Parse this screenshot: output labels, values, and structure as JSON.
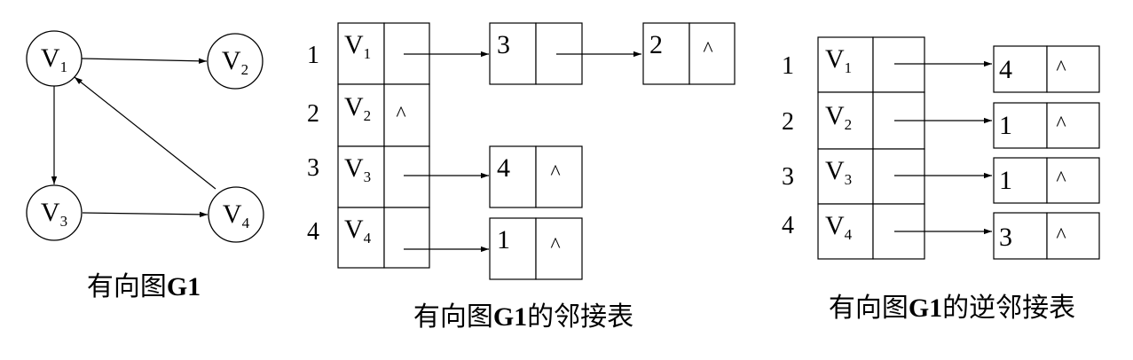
{
  "graph": {
    "vertex_base": "V",
    "nodes": [
      {
        "id": "v1",
        "sub": "1"
      },
      {
        "id": "v2",
        "sub": "2"
      },
      {
        "id": "v3",
        "sub": "3"
      },
      {
        "id": "v4",
        "sub": "4"
      }
    ],
    "edges": [
      {
        "from": "v1",
        "to": "v2"
      },
      {
        "from": "v1",
        "to": "v3"
      },
      {
        "from": "v3",
        "to": "v4"
      },
      {
        "from": "v4",
        "to": "v1"
      }
    ],
    "caption": {
      "text": "有向图",
      "bold": "G1"
    }
  },
  "adjacency_list": {
    "caption": {
      "prefix": "有向图",
      "bold": "G1",
      "suffix": "的邻接表"
    },
    "rows": [
      {
        "index": "1",
        "vertex_sub": "1",
        "head_null": false,
        "nodes": [
          {
            "value": "3",
            "null": false
          },
          {
            "value": "2",
            "null": true
          }
        ]
      },
      {
        "index": "2",
        "vertex_sub": "2",
        "head_null": true,
        "nodes": []
      },
      {
        "index": "3",
        "vertex_sub": "3",
        "head_null": false,
        "nodes": [
          {
            "value": "4",
            "null": true
          }
        ]
      },
      {
        "index": "4",
        "vertex_sub": "4",
        "head_null": false,
        "nodes": [
          {
            "value": "1",
            "null": true
          }
        ]
      }
    ]
  },
  "inverse_adjacency_list": {
    "caption": {
      "prefix": "有向图",
      "bold": "G1",
      "suffix": "的逆邻接表"
    },
    "rows": [
      {
        "index": "1",
        "vertex_sub": "1",
        "nodes": [
          {
            "value": "4",
            "null": true
          }
        ]
      },
      {
        "index": "2",
        "vertex_sub": "2",
        "nodes": [
          {
            "value": "1",
            "null": true
          }
        ]
      },
      {
        "index": "3",
        "vertex_sub": "3",
        "nodes": [
          {
            "value": "1",
            "null": true
          }
        ]
      },
      {
        "index": "4",
        "vertex_sub": "4",
        "nodes": [
          {
            "value": "3",
            "null": true
          }
        ]
      }
    ]
  },
  "null_symbol": "^"
}
